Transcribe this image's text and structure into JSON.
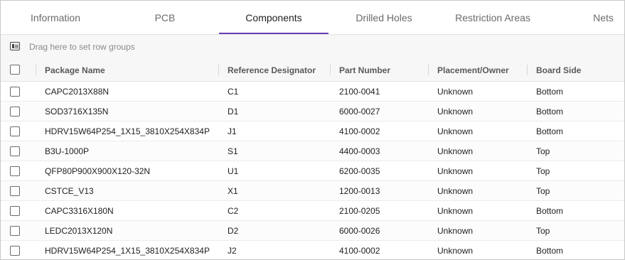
{
  "tabs": [
    {
      "label": "Information",
      "active": false
    },
    {
      "label": "PCB",
      "active": false
    },
    {
      "label": "Components",
      "active": true
    },
    {
      "label": "Drilled Holes",
      "active": false
    },
    {
      "label": "Restriction Areas",
      "active": false
    },
    {
      "label": "Nets",
      "active": false
    }
  ],
  "group_panel": {
    "placeholder": "Drag here to set row groups",
    "icon": "row-group-icon"
  },
  "columns": [
    "Package Name",
    "Reference Designator",
    "Part Number",
    "Placement/Owner",
    "Board Side"
  ],
  "rows": [
    {
      "package": "CAPC2013X88N",
      "ref": "C1",
      "part": "2100-0041",
      "owner": "Unknown",
      "side": "Bottom"
    },
    {
      "package": "SOD3716X135N",
      "ref": "D1",
      "part": "6000-0027",
      "owner": "Unknown",
      "side": "Bottom"
    },
    {
      "package": "HDRV15W64P254_1X15_3810X254X834P",
      "ref": "J1",
      "part": "4100-0002",
      "owner": "Unknown",
      "side": "Bottom"
    },
    {
      "package": "B3U-1000P",
      "ref": "S1",
      "part": "4400-0003",
      "owner": "Unknown",
      "side": "Top"
    },
    {
      "package": "QFP80P900X900X120-32N",
      "ref": "U1",
      "part": "6200-0035",
      "owner": "Unknown",
      "side": "Top"
    },
    {
      "package": "CSTCE_V13",
      "ref": "X1",
      "part": "1200-0013",
      "owner": "Unknown",
      "side": "Top"
    },
    {
      "package": "CAPC3316X180N",
      "ref": "C2",
      "part": "2100-0205",
      "owner": "Unknown",
      "side": "Bottom"
    },
    {
      "package": "LEDC2013X120N",
      "ref": "D2",
      "part": "6000-0026",
      "owner": "Unknown",
      "side": "Top"
    },
    {
      "package": "HDRV15W64P254_1X15_3810X254X834P",
      "ref": "J2",
      "part": "4100-0002",
      "owner": "Unknown",
      "side": "Bottom"
    }
  ],
  "colors": {
    "accent": "#6a3fb5",
    "header_bg": "#f7f7f8"
  }
}
